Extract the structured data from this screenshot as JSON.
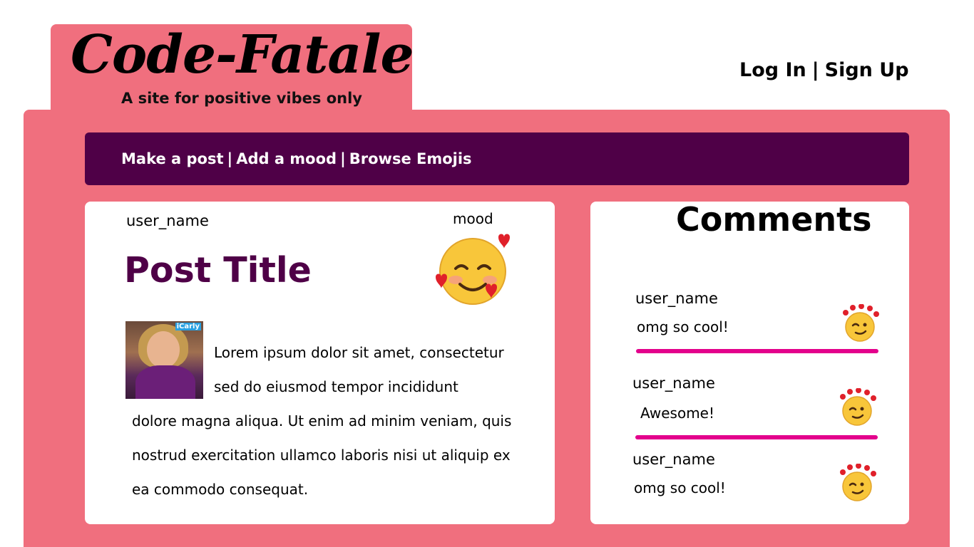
{
  "header": {
    "logo_title": "Code-Fatale",
    "tagline": "A site for positive vibes only",
    "auth": {
      "login": "Log In",
      "separator": "|",
      "signup": "Sign Up"
    }
  },
  "nav": {
    "items": [
      "Make a post",
      "Add a mood",
      "Browse Emojis"
    ],
    "separator": "|"
  },
  "post": {
    "user_name": "user_name",
    "mood_label": "mood",
    "mood_icon": "smiling-face-with-hearts",
    "title": "Post Title",
    "image_badge": "iCarly",
    "body_lines": [
      "Lorem ipsum dolor sit amet, consectetur",
      "sed do eiusmod tempor incididunt",
      "dolore magna aliqua. Ut enim ad minim veniam, quis",
      "nostrud exercitation ullamco laboris nisi ut aliquip ex",
      "ea commodo consequat."
    ]
  },
  "comments": {
    "title": "Comments",
    "items": [
      {
        "user": "user_name",
        "text": "omg so cool!",
        "icon": "winking-face-with-heart-halo"
      },
      {
        "user": "user_name",
        "text": "Awesome!",
        "icon": "winking-face-with-heart-halo"
      },
      {
        "user": "user_name",
        "text": "omg so cool!",
        "icon": "winking-face-with-heart-halo"
      }
    ]
  },
  "colors": {
    "panel": "#f06f7e",
    "nav_bg": "#4f0047",
    "title": "#4f0047",
    "divider": "#e3008c"
  }
}
